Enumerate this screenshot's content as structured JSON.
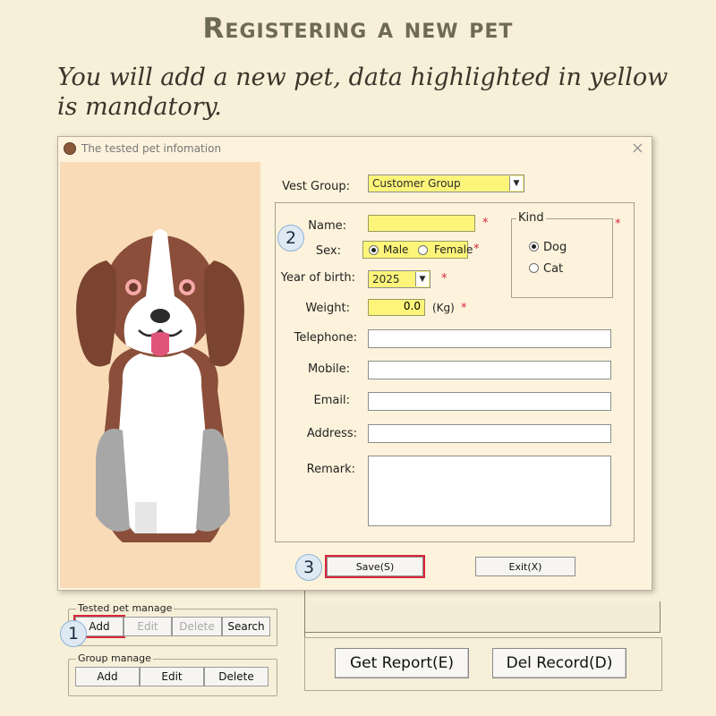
{
  "heading": "Registering a new pet",
  "instruction": "You will add a new pet, data highlighted in yellow is mandatory.",
  "dialog": {
    "title": "The tested pet infomation",
    "close_glyph": "×",
    "fields": {
      "vest_group_label": "Vest Group:",
      "vest_group_value": "Customer Group",
      "name_label": "Name:",
      "name_value": "",
      "sex_label": "Sex:",
      "sex_options": [
        "Male",
        "Female"
      ],
      "sex_selected": "Male",
      "year_label": "Year of birth:",
      "year_value": "2025",
      "weight_label": "Weight:",
      "weight_value": "0.0",
      "weight_unit": "(Kg)",
      "telephone_label": "Telephone:",
      "mobile_label": "Mobile:",
      "email_label": "Email:",
      "address_label": "Address:",
      "remark_label": "Remark:",
      "required_mark": "*"
    },
    "kind": {
      "title": "Kind",
      "options": [
        "Dog",
        "Cat"
      ],
      "selected": "Dog"
    },
    "buttons": {
      "save": "Save(S)",
      "exit": "Exit(X)"
    }
  },
  "background_app": {
    "tested_pet_manage": {
      "title": "Tested pet manage",
      "buttons": [
        "Add",
        "Edit",
        "Delete",
        "Search"
      ]
    },
    "group_manage": {
      "title": "Group manage",
      "buttons": [
        "Add",
        "Edit",
        "Delete"
      ]
    },
    "get_report": "Get Report(E)",
    "del_record": "Del Record(D)"
  },
  "markers": [
    "1",
    "2",
    "3"
  ],
  "colors": {
    "mandatory_yellow": "#fdf57a",
    "highlight_red": "#d8263a",
    "page_background": "#f7efd8",
    "pet_pane": "#f9dcb7"
  },
  "icons": {
    "pet": "dog-illustration",
    "titlebar": "paw-icon"
  }
}
